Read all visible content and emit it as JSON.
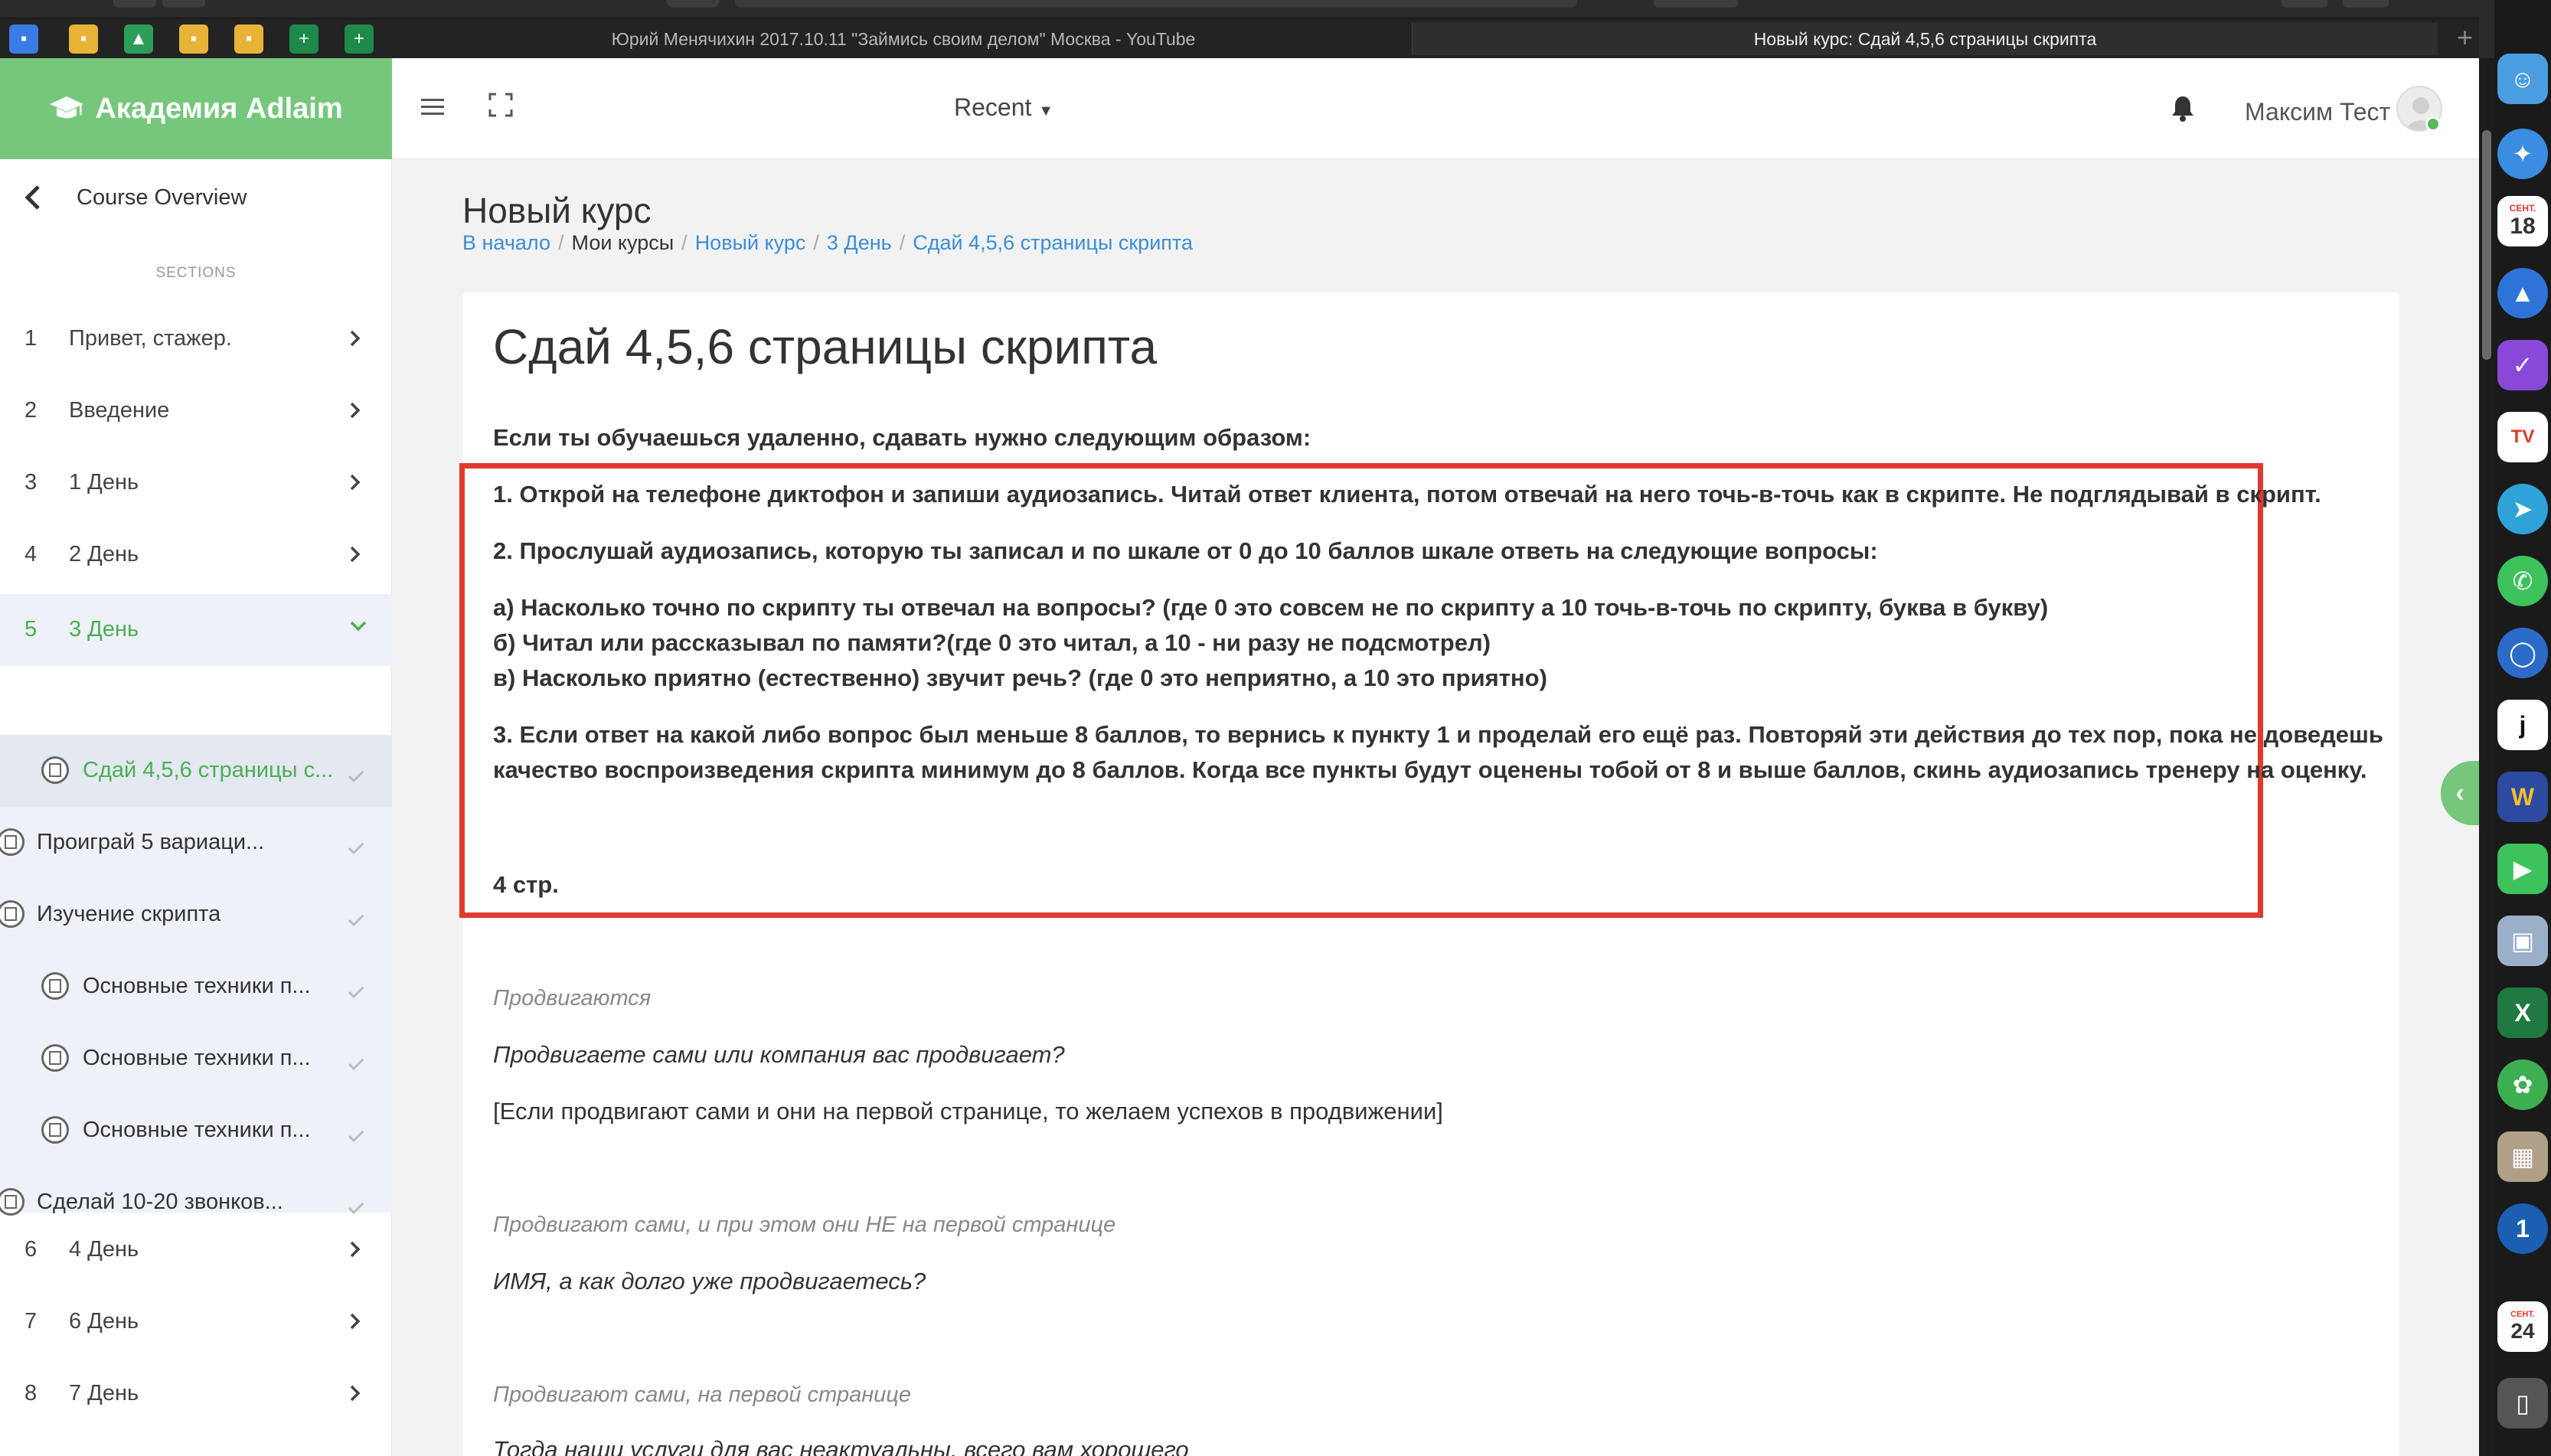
{
  "browser": {
    "tabs": [
      {
        "title": "Юрий Менячихин 2017.10.11 \"Займись своим делом\" Москва - YouTube"
      },
      {
        "title": "Новый курс: Сдай 4,5,6 страницы скрипта"
      }
    ],
    "new_tab_label": "+"
  },
  "brand": {
    "name": "Академия Adlaim",
    "color": "#76c77c"
  },
  "topnav": {
    "recent_label": "Recent",
    "user_name": "Максим Тест"
  },
  "sidebar": {
    "back_label": "Course Overview",
    "sections_heading": "SECTIONS",
    "sections": [
      {
        "num": "1",
        "name": "Привет, стажер."
      },
      {
        "num": "2",
        "name": "Введение"
      },
      {
        "num": "3",
        "name": "1 День"
      },
      {
        "num": "4",
        "name": "2 День"
      },
      {
        "num": "5",
        "name": "3 День"
      },
      {
        "num": "6",
        "name": "4 День"
      },
      {
        "num": "7",
        "name": "6 День"
      },
      {
        "num": "8",
        "name": "7 День"
      }
    ],
    "activities": [
      {
        "name": "Сдай 4,5,6 страницы с..."
      },
      {
        "name": "Проиграй 5 вариаци..."
      },
      {
        "name": "Изучение скрипта"
      },
      {
        "name": "Основные техники п..."
      },
      {
        "name": "Основные техники п..."
      },
      {
        "name": "Основные техники п..."
      },
      {
        "name": "Сделай 10-20 звонков..."
      }
    ]
  },
  "page": {
    "course_title": "Новый курс",
    "breadcrumb": [
      "В начало",
      "Мои курсы",
      "Новый курс",
      "3 День",
      "Сдай 4,5,6 страницы скрипта"
    ],
    "heading": "Сдай 4,5,6 страницы скрипта",
    "instructions": [
      "Если ты обучаешься удаленно, сдавать нужно следующим образом:",
      "1. Открой на телефоне диктофон и запиши аудиозапись. Читай ответ клиента, потом отвечай на него точь-в-точь как в скрипте. Не подглядывай в скрипт.",
      "2. Прослушай аудиозапись, которую ты записал и по шкале от 0 до 10 баллов шкале ответь на следующие вопросы:",
      "а) Насколько точно по скрипту ты отвечал на вопросы? (где 0 это совсем не по скрипту а 10 точь-в-точь по скрипту, буква в букву)",
      "б) Читал или рассказывал по памяти?(где 0  это читал, а 10 - ни разу не подсмотрел)",
      "в) Насколько приятно (естественно) звучит речь? (где 0 это неприятно,  а 10 это приятно)",
      "3. Если ответ на какой либо вопрос был меньше 8 баллов, то вернись к пункту  1  и проделай его ещё раз. Повторяй эти действия до тех пор, пока не доведешь",
      "качество воспроизведения скрипта минимум до 8 баллов. Когда все пункты будут оценены тобой от 8 и выше баллов, скинь аудиозапись тренеру на оценку."
    ],
    "page_label": "4 стр.",
    "script": [
      {
        "label": "Продвигаются",
        "question": "Продвигаете сами или компания вас продвигает?",
        "note": "[Если продвигают сами и они на первой странице, то желаем успехов в продвижении]"
      },
      {
        "label": "Продвигают сами, и при этом они НЕ на первой странице",
        "question": "ИМЯ, а как долго уже продвигаетесь?"
      },
      {
        "label": "Продвигают сами, на первой странице",
        "question": "Тогда наши услуги для вас неактуальны, всего вам хорошего"
      }
    ]
  },
  "dock": {
    "calendar_month": "СЕНТ.",
    "calendar_day": "18",
    "calendar_day2": "24"
  }
}
